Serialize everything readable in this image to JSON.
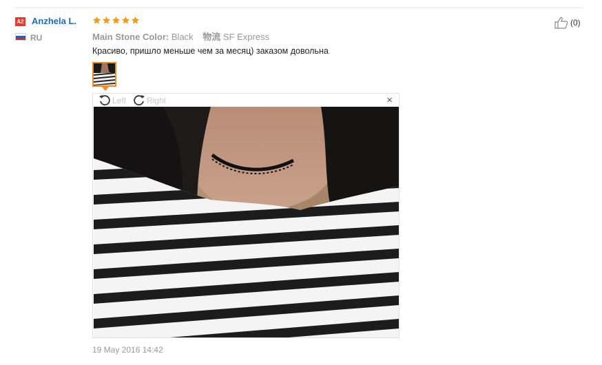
{
  "reviewer": {
    "level_badge": "A2",
    "name": "Anzhela L.",
    "country_code": "RU",
    "flag_icon": "russia-flag-icon"
  },
  "review": {
    "rating": 5,
    "rating_max": 5,
    "star_color": "#f29a1a",
    "attributes": [
      {
        "key": "Main Stone Color:",
        "value": "Black"
      },
      {
        "key": "物流",
        "value": "SF Express"
      }
    ],
    "text": "Красиво, пришло меньше чем за месяц) заказом довольна",
    "date": "19 May 2016 14:42"
  },
  "viewer": {
    "rotate_left_label": "Left",
    "rotate_right_label": "Right",
    "close_symbol": "×",
    "photo_description": "selfie photo showing black tattoo choker necklace with black and white striped shirt"
  },
  "helpful": {
    "icon": "thumbs-up-icon",
    "count": "(0)"
  },
  "colors": {
    "link_blue": "#1a6bc4",
    "badge_red": "#e8392c",
    "accent_orange": "#f08a24"
  }
}
